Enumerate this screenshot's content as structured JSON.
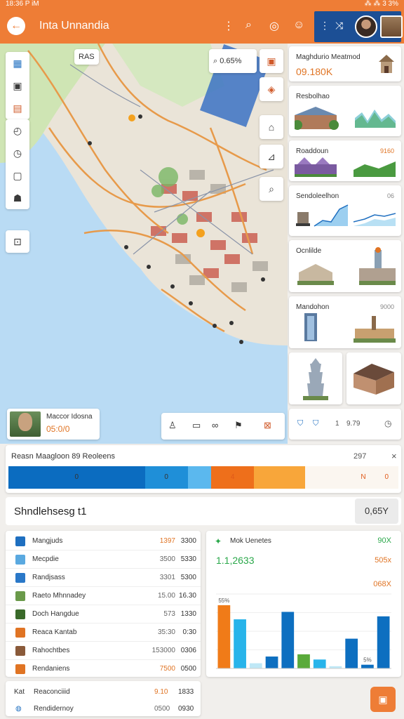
{
  "status": {
    "time": "18:36 P iM",
    "right": "⁂ ⁂ 3 3%"
  },
  "app": {
    "title": "Inta Unnandia",
    "back_label": "←"
  },
  "map": {
    "scale_label": "RAS",
    "search_chip": "0.65%",
    "profile": {
      "name": "Maccor Idosna",
      "value": "05:0/0"
    },
    "toolbar_icons": [
      "person-icon",
      "camera-icon",
      "eye-icon",
      "flag-icon",
      "map-icon"
    ]
  },
  "right_cards": [
    {
      "title": "Maghdurio Meatmod",
      "value": "09.180K",
      "num": ""
    },
    {
      "title": "Resbolhao",
      "value": "",
      "num": ""
    },
    {
      "title": "Roaddoun",
      "value": "",
      "num": "9160"
    },
    {
      "title": "Sendoleelhon",
      "value": "",
      "num": "06"
    },
    {
      "title": "Ocnlilde",
      "value": "",
      "num": ""
    },
    {
      "title": "Mandohon",
      "value": "",
      "num": "9000"
    },
    {
      "title": "",
      "value": "",
      "num": ""
    }
  ],
  "stat_strip": {
    "label_a": "1",
    "label_b": "9.79",
    "icons": [
      "shield-icon",
      "shield-icon",
      "clock-icon"
    ]
  },
  "summary": {
    "title": "Reasn Maagloon 89 Reoleens",
    "count": "297",
    "close": "×",
    "segments": [
      {
        "label": "0",
        "value": 35,
        "color": "#0b6cc0"
      },
      {
        "label": "0",
        "value": 11,
        "color": "#1f8fd8"
      },
      {
        "label": "",
        "value": 6,
        "color": "#5bb8ee"
      },
      {
        "label": "4",
        "value": 11,
        "color": "#ee6f1b"
      },
      {
        "label": "",
        "value": 13,
        "color": "#f8a63a"
      },
      {
        "label": "",
        "value": 12,
        "color": "#fbf6f0"
      },
      {
        "label": "N",
        "value": 6,
        "color": "#fbf6f0"
      },
      {
        "label": "0",
        "value": 6,
        "color": "#fbf6f0"
      }
    ]
  },
  "headline": {
    "text": "Shndlehsesg t1",
    "badge": "0,65Y"
  },
  "list": {
    "rows": [
      {
        "name": "Mangjuds",
        "a": "1397",
        "b": "3300",
        "color": "#1e6fc0",
        "a_orange": true
      },
      {
        "name": "Mecpdie",
        "a": "3500",
        "b": "5330",
        "color": "#5aa9e0",
        "a_orange": false
      },
      {
        "name": "Randjsass",
        "a": "3301",
        "b": "5300",
        "color": "#2a78c8",
        "a_orange": false
      },
      {
        "name": "Raeto Mhnnadey",
        "a": "15.00",
        "b": "16.30",
        "color": "#6a9a4a",
        "a_orange": false
      },
      {
        "name": "Doch Hangdue",
        "a": "573",
        "b": "1330",
        "color": "#3a6a2a",
        "a_orange": false
      },
      {
        "name": "Reaca Kantab",
        "a": "35:30",
        "b": "0:30",
        "color": "#e07424",
        "a_orange": false
      },
      {
        "name": "Rahochtbes",
        "a": "153000",
        "b": "0306",
        "color": "#8a5a3a",
        "a_orange": false
      },
      {
        "name": "Rendaniens",
        "a": "7500",
        "b": "0500",
        "color": "#e07424",
        "a_orange": true
      }
    ]
  },
  "bottom": {
    "rows": [
      {
        "name": "Reaconciiid",
        "a": "9.10",
        "b": "1833"
      },
      {
        "name": "Rendidernoy",
        "a": "0500",
        "b": "0930"
      }
    ],
    "label": "Kat"
  },
  "chart_panel": {
    "title": "Mok Uenetes",
    "pct": "90X",
    "total": "1.1,2633",
    "sub": "505x",
    "peak": "068X"
  },
  "chart_data": {
    "type": "bar",
    "categories": [
      "1",
      "2",
      "3",
      "4",
      "5",
      "6",
      "7",
      "8",
      "9",
      "10",
      "11"
    ],
    "values": [
      85,
      66,
      7,
      16,
      76,
      19,
      12,
      3,
      40,
      5,
      70
    ],
    "colors": [
      "#f07b18",
      "#28b4ea",
      "#bfe8f6",
      "#0d6fc0",
      "#0d6fc0",
      "#5aaa3a",
      "#28b4ea",
      "#bfe8f6",
      "#0d6fc0",
      "#0d6fc0",
      "#0d6fc0"
    ],
    "labels": [
      "55%",
      "",
      "",
      "",
      "",
      "",
      "",
      "",
      "",
      "5%",
      ""
    ],
    "ylim": [
      0,
      100
    ],
    "grid": true
  }
}
